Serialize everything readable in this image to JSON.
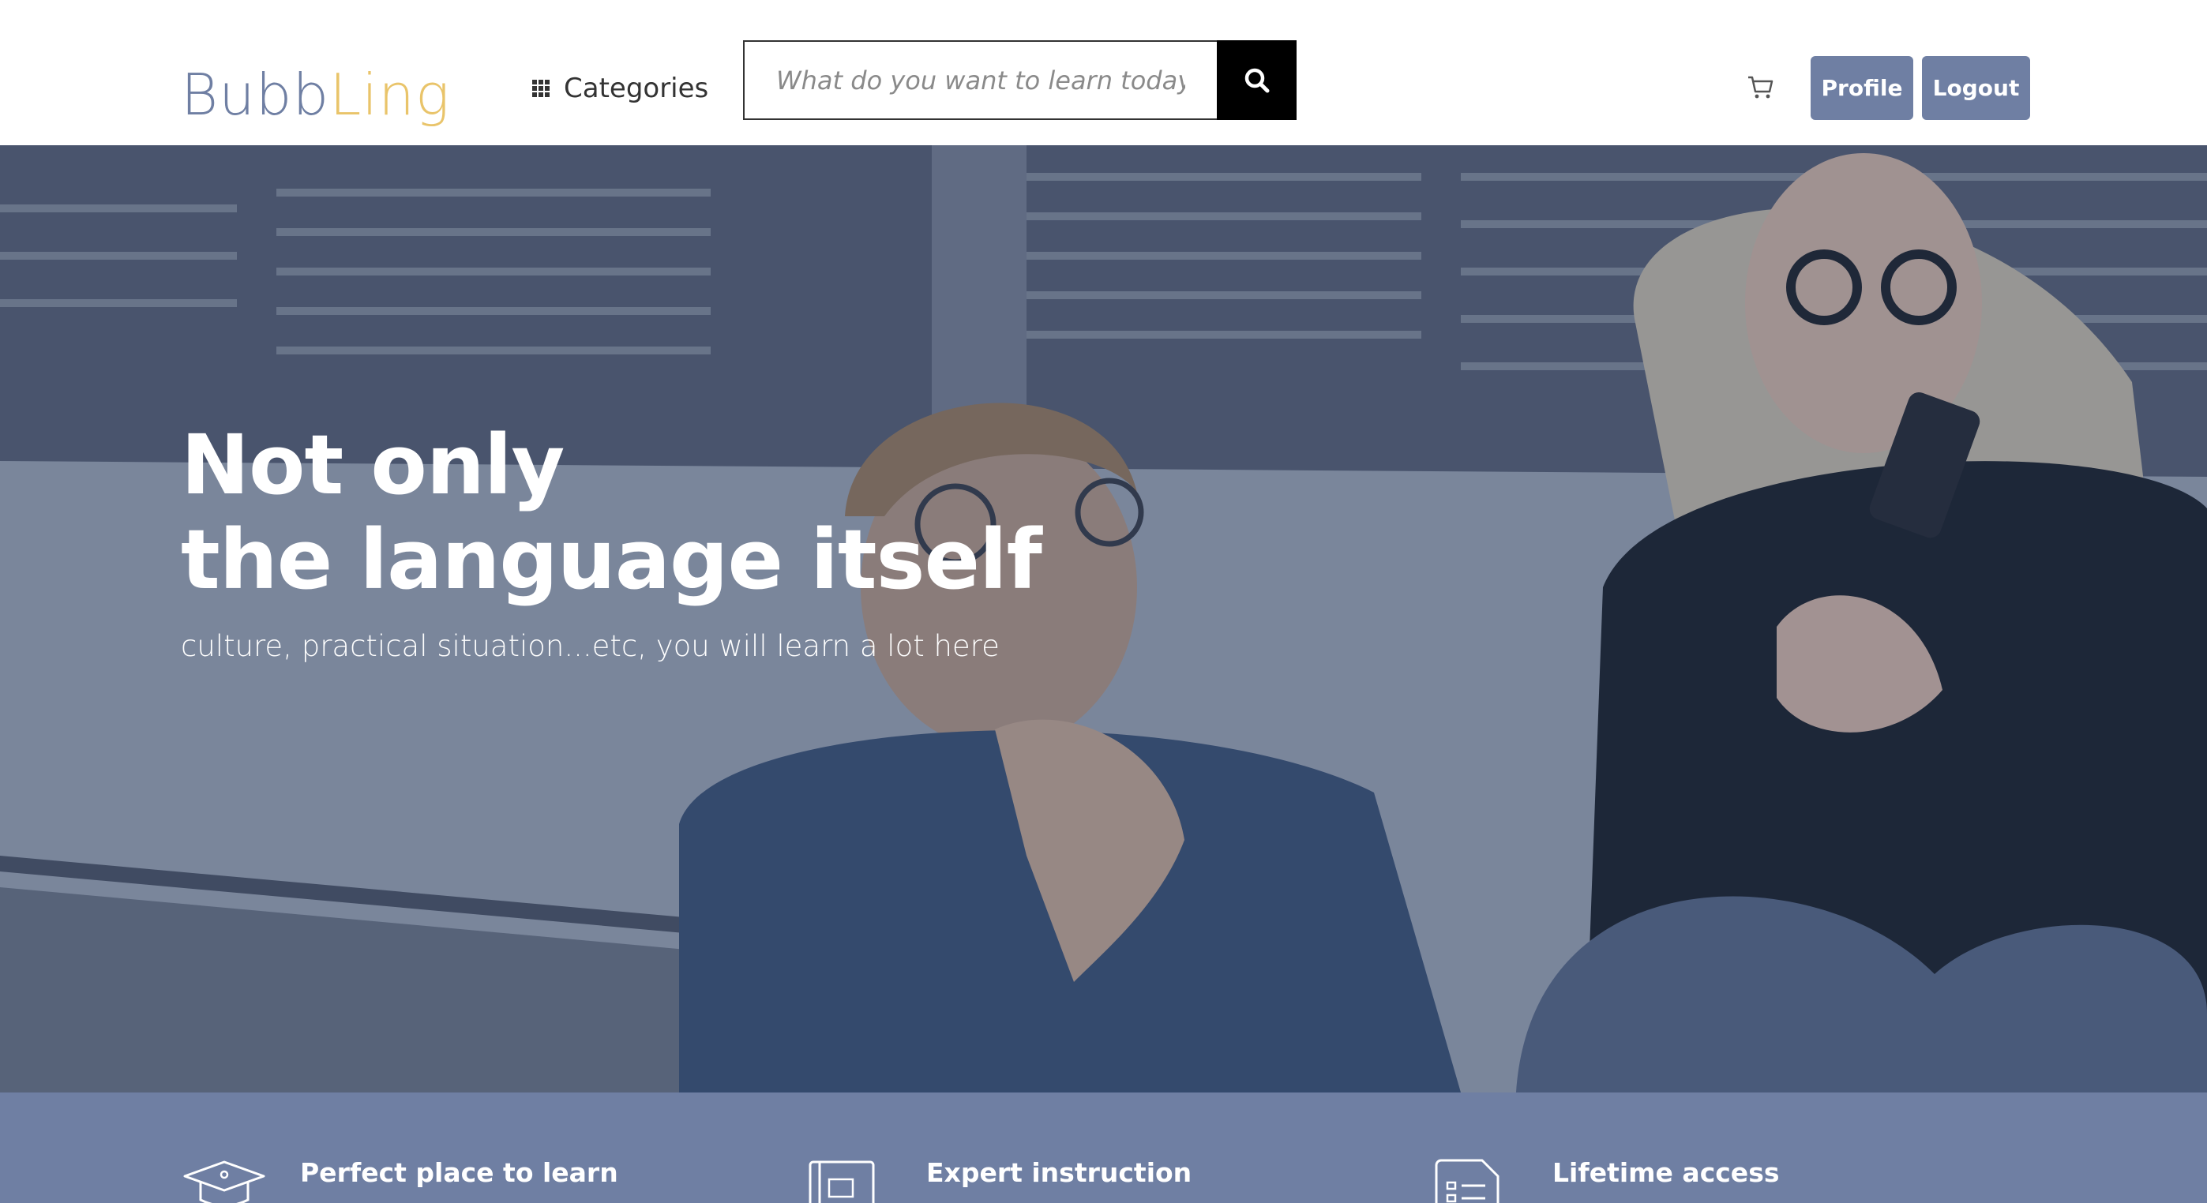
{
  "header": {
    "logo": {
      "part_a": "Bubb",
      "part_b": "Ling",
      "bubble_glyph": "..."
    },
    "categories_label": "Categories",
    "search": {
      "placeholder": "What do you want to learn today?",
      "value": ""
    },
    "profile_label": "Profile",
    "logout_label": "Logout"
  },
  "hero": {
    "title_line1": "Not only",
    "title_line2": "the language itself",
    "subtitle": "culture, practical situation...etc, you will learn a lot here"
  },
  "features": [
    {
      "title": "Perfect place to learn",
      "icon": "graduation-cap-icon"
    },
    {
      "title": "Expert instruction",
      "icon": "book-icon"
    },
    {
      "title": "Lifetime access",
      "icon": "document-list-icon"
    }
  ],
  "colors": {
    "brand_blue": "#6f7fa3",
    "brand_yellow": "#e9c46a",
    "search_button": "#000000"
  }
}
